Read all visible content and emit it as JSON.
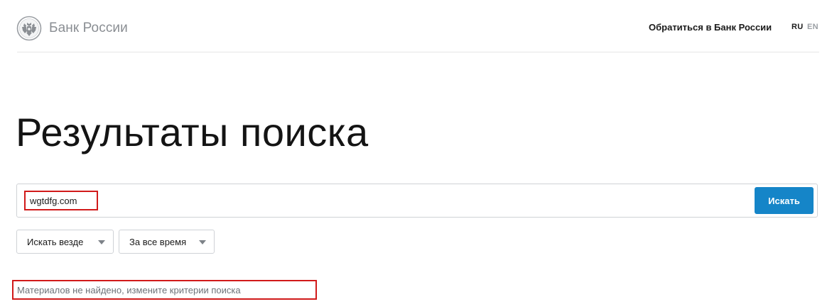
{
  "header": {
    "logo_text": "Банк России",
    "contact_link": "Обратиться в Банк России",
    "languages": {
      "ru": "RU",
      "en": "EN"
    }
  },
  "main": {
    "title": "Результаты поиска",
    "search": {
      "value": "wgtdfg.com",
      "button_label": "Искать"
    },
    "filters": {
      "scope": "Искать везде",
      "period": "За все время"
    },
    "no_results_message": "Материалов не найдено, измените критерии поиска"
  },
  "colors": {
    "accent": "#1585c8",
    "highlight": "#d11a1a"
  }
}
